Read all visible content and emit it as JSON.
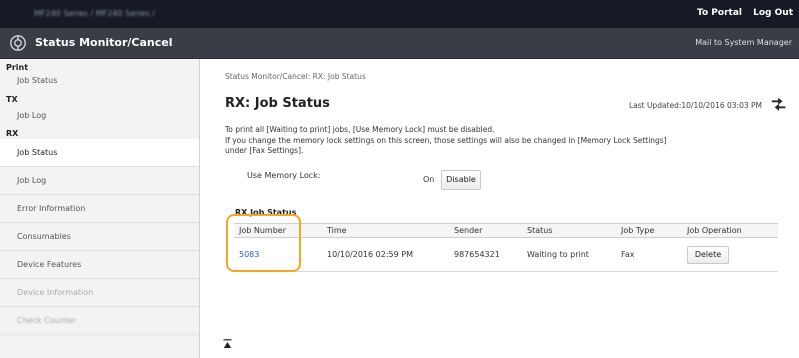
{
  "topbar": {
    "breadcrumb": "MF240 Series / MF240 Series /",
    "portal_link": "To Portal",
    "logout_link": "Log Out"
  },
  "header": {
    "title": "Status Monitor/Cancel",
    "mail_link": "Mail to System Manager"
  },
  "sidebar": {
    "print_head": "Print",
    "print_job_status": "Job Status",
    "tx_head": "TX",
    "tx_job_log": "Job Log",
    "rx_head": "RX",
    "items": [
      {
        "label": "Job Status"
      },
      {
        "label": "Job Log"
      },
      {
        "label": "Error Information"
      },
      {
        "label": "Consumables"
      },
      {
        "label": "Device Features"
      },
      {
        "label": "Device Information"
      },
      {
        "label": "Check Counter"
      }
    ]
  },
  "main": {
    "breadcrumb": "Status Monitor/Cancel: RX: Job Status",
    "title": "RX: Job Status",
    "last_updated": "Last Updated:10/10/2016 03:03 PM",
    "description_line1": "To print all [Waiting to print] jobs, [Use Memory Lock] must be disabled.",
    "description_line2": "If you change the memory lock settings on this screen, those settings will also be changed in [Memory Lock Settings]",
    "description_line3": "under [Fax Settings].",
    "memory_lock_label": "Use Memory Lock:",
    "memory_lock_value": "On",
    "disable_button": "Disable",
    "rx_status_heading": "RX Job Status"
  },
  "table": {
    "headers": [
      "Job Number",
      "Time",
      "Sender",
      "Status",
      "Job Type",
      "Job Operation"
    ],
    "rows": [
      {
        "job_number": "5083",
        "time": "10/10/2016 02:59 PM",
        "sender": "987654321",
        "status": "Waiting to print",
        "job_type": "Fax",
        "operation": "Delete"
      }
    ]
  },
  "colors": {
    "topbar": "#151a26",
    "titlebar": "#3a3d45",
    "link": "#2c64b5",
    "highlight": "#f5a623"
  },
  "icons": [
    "canon-logo-icon",
    "refresh-icon",
    "collapse-icon"
  ]
}
